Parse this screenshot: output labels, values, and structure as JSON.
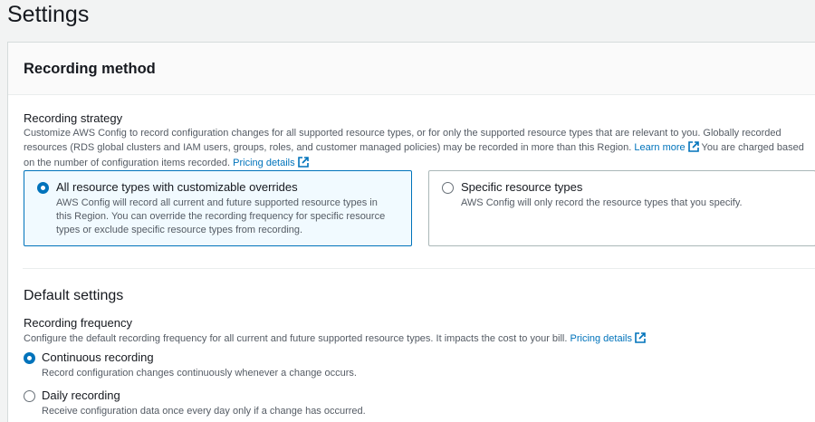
{
  "page": {
    "title": "Settings"
  },
  "recording_method": {
    "heading": "Recording method",
    "strategy": {
      "label": "Recording strategy",
      "description_1": "Customize AWS Config to record configuration changes for all supported resource types, or for only the supported resource types that are relevant to you. Globally recorded",
      "description_2a": "resources (RDS global clusters and IAM users, groups, roles, and customer managed policies) may be recorded in more than this Region.",
      "learn_more": "Learn more",
      "description_2b": "You are charged based",
      "description_3": "on the number of configuration items recorded.",
      "pricing_link": "Pricing details"
    },
    "options": [
      {
        "title": "All resource types with customizable overrides",
        "desc_1": "AWS Config will record all current and future supported resource types in",
        "desc_2": "this Region. You can override the recording frequency for specific resource",
        "desc_3": "types or exclude specific resource types from recording.",
        "selected": true
      },
      {
        "title": "Specific resource types",
        "desc_1": "AWS Config will only record the resource types that you specify.",
        "selected": false
      }
    ]
  },
  "default_settings": {
    "heading": "Default settings",
    "frequency": {
      "label": "Recording frequency",
      "description": "Configure the default recording frequency for all current and future supported resource types. It impacts the cost to your bill.",
      "pricing_link": "Pricing details"
    },
    "options": [
      {
        "title": "Continuous recording",
        "desc": "Record configuration changes continuously whenever a change occurs.",
        "selected": true
      },
      {
        "title": "Daily recording",
        "desc": "Receive configuration data once every day only if a change has occurred.",
        "selected": false
      }
    ]
  },
  "colors": {
    "accent": "#0073bb",
    "text": "#16191f",
    "muted": "#545b64",
    "selected_bg": "#f1faff"
  }
}
